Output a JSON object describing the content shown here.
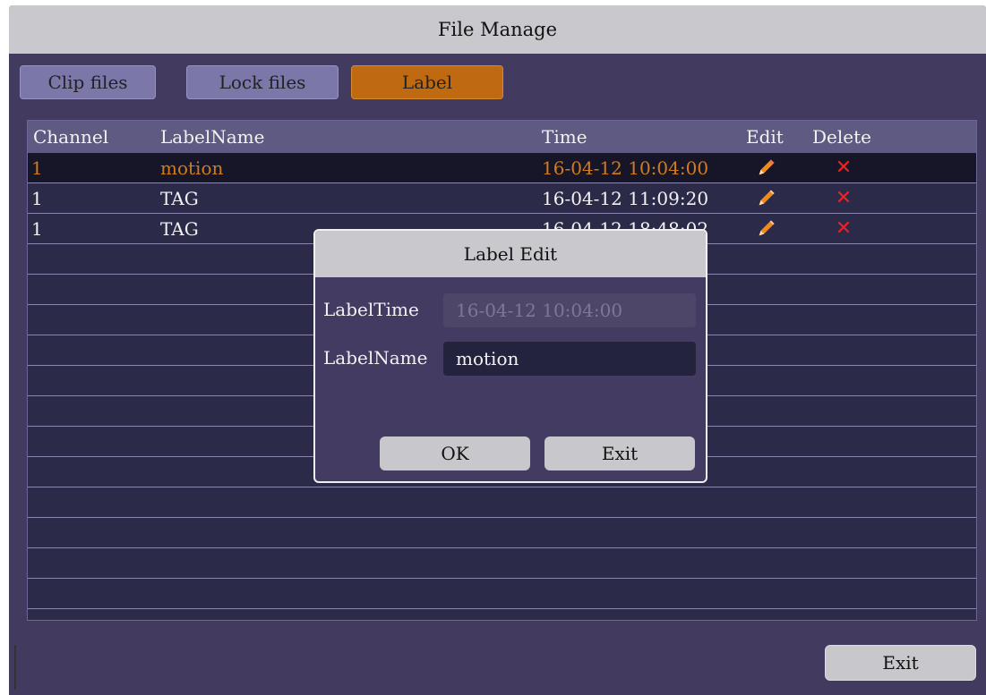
{
  "window": {
    "title": "File Manage"
  },
  "tabs": [
    {
      "label": "Clip files",
      "active": false
    },
    {
      "label": "Lock files",
      "active": false
    },
    {
      "label": "Label",
      "active": true
    }
  ],
  "table": {
    "headers": {
      "channel": "Channel",
      "label_name": "LabelName",
      "time": "Time",
      "edit": "Edit",
      "delete": "Delete"
    },
    "rows": [
      {
        "channel": "1",
        "label_name": "motion",
        "time": "16-04-12 10:04:00",
        "selected": true
      },
      {
        "channel": "1",
        "label_name": "TAG",
        "time": "16-04-12 11:09:20",
        "selected": false
      },
      {
        "channel": "1",
        "label_name": "TAG",
        "time": "16-04-12 18:48:02",
        "selected": false
      }
    ],
    "delete_glyph": "✕",
    "edit_icon": "pencil-icon",
    "delete_icon": "delete-x-icon"
  },
  "footer": {
    "exit_label": "Exit"
  },
  "dialog": {
    "title": "Label Edit",
    "label_time_label": "LabelTime",
    "label_time_value": "16-04-12 10:04:00",
    "label_name_label": "LabelName",
    "label_name_value": "motion",
    "ok_label": "OK",
    "exit_label": "Exit"
  },
  "colors": {
    "background": "#433a5f",
    "titlebar": "#c9c8cd",
    "tab": "#7b77a8",
    "tab_active": "#bf6a10",
    "table": "#2b2a49",
    "table_header": "#5f5a82",
    "selected_row": "#171628",
    "selected_text": "#d07c1e",
    "pencil": "#f28a1a",
    "delete": "#ee2222"
  }
}
